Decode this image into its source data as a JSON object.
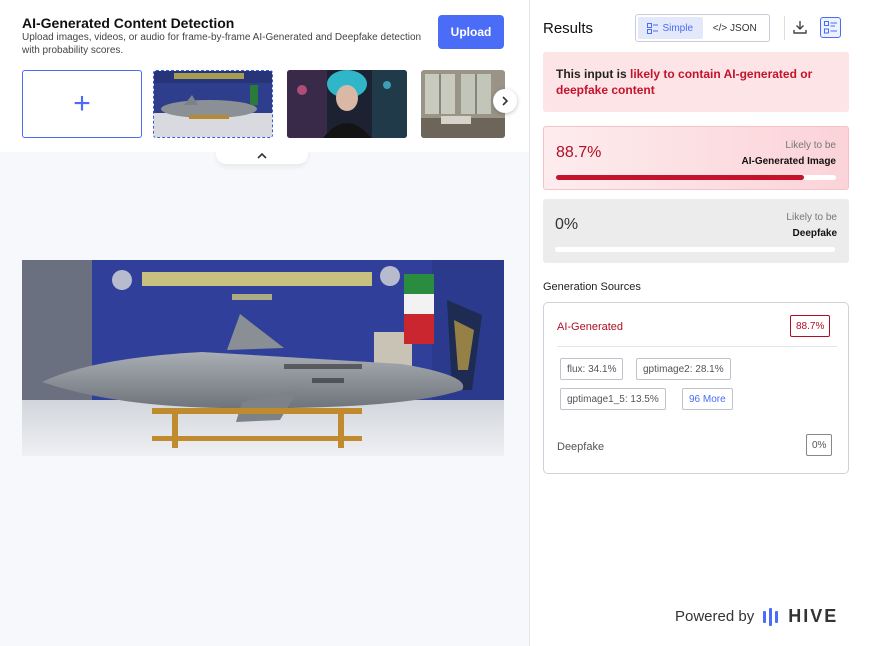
{
  "header": {
    "title": "AI-Generated Content Detection",
    "subtitle": "Upload images, videos, or audio for frame-by-frame AI-Generated and Deepfake detection with probability scores.",
    "upload_label": "Upload"
  },
  "gallery": {
    "add_symbol": "+",
    "thumbnails": [
      "drone-photo",
      "cyberpunk-portrait",
      "interior-room"
    ]
  },
  "results": {
    "title": "Results",
    "view_simple": "Simple",
    "view_json": "</> JSON",
    "alert_prefix": "This input is ",
    "alert_highlight": "likely to contain AI-generated or deepfake content",
    "ai_score": {
      "value": "88.7%",
      "fraction": 0.887,
      "caption": "Likely to be",
      "label": "AI-Generated Image"
    },
    "deepfake_score": {
      "value": "0%",
      "fraction": 0.0,
      "caption": "Likely to be",
      "label": "Deepfake"
    }
  },
  "generation": {
    "title": "Generation Sources",
    "ai_label": "AI-Generated",
    "ai_value": "88.7%",
    "sources": [
      "flux: 34.1%",
      "gptimage2: 28.1%",
      "gptimage1_5: 13.5%"
    ],
    "more_label": "96 More",
    "deepfake_label": "Deepfake",
    "deepfake_value": "0%"
  },
  "footer": {
    "powered_by": "Powered by",
    "brand": "HIVE"
  },
  "colors": {
    "accent": "#4a6cf7",
    "danger": "#c4132b"
  }
}
